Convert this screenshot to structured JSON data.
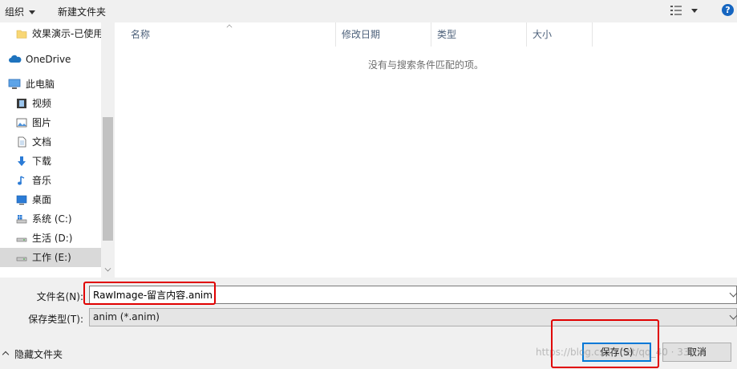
{
  "toolbar": {
    "organize_label": "组织",
    "new_folder_label": "新建文件夹",
    "help_label": "?"
  },
  "nav": {
    "items": [
      {
        "label": "效果演示-已使用",
        "icon": "folder-icon"
      },
      {
        "label": "OneDrive",
        "icon": "cloud-icon"
      },
      {
        "label": "此电脑",
        "icon": "computer-icon"
      },
      {
        "label": "视频",
        "icon": "video-icon"
      },
      {
        "label": "图片",
        "icon": "pictures-icon"
      },
      {
        "label": "文档",
        "icon": "documents-icon"
      },
      {
        "label": "下载",
        "icon": "download-icon"
      },
      {
        "label": "音乐",
        "icon": "music-icon"
      },
      {
        "label": "桌面",
        "icon": "desktop-icon"
      },
      {
        "label": "系统 (C:)",
        "icon": "drive-icon"
      },
      {
        "label": "生活 (D:)",
        "icon": "drive-icon"
      },
      {
        "label": "工作 (E:)",
        "icon": "drive-icon",
        "selected": true
      }
    ]
  },
  "filelist": {
    "columns": [
      "名称",
      "修改日期",
      "类型",
      "大小"
    ],
    "empty_message": "没有与搜索条件匹配的项。"
  },
  "form": {
    "filename_label": "文件名(N):",
    "filename_value": "RawImage-留言内容.anim",
    "filetype_label": "保存类型(T):",
    "filetype_value": "anim (*.anim)"
  },
  "footer": {
    "hide_folders_label": "隐藏文件夹",
    "save_label": "保存(S)",
    "cancel_label": "取消",
    "watermark_text": "https://blog.csdn.net/qq_40 · 338"
  },
  "colors": {
    "highlight_red": "#e00000",
    "accent_blue": "#0078d7"
  }
}
